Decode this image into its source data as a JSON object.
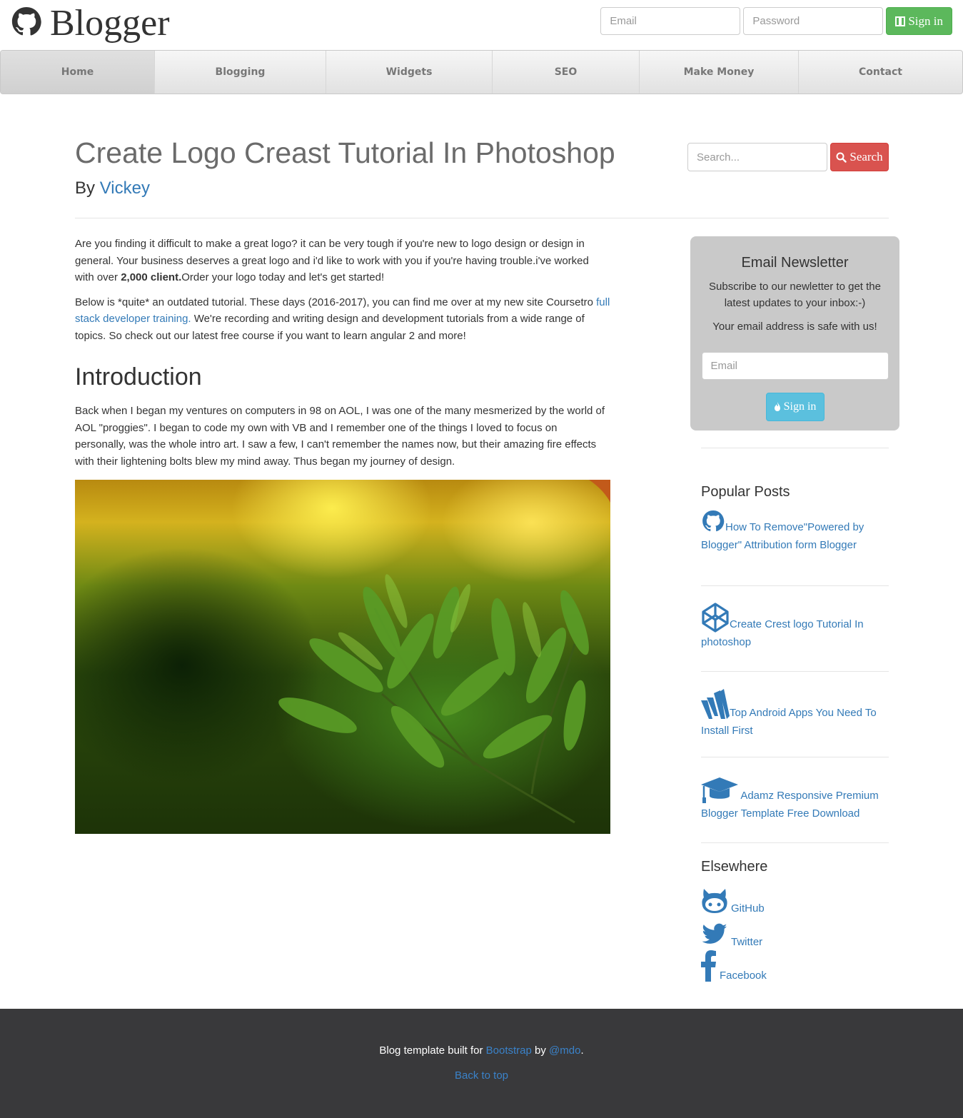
{
  "header": {
    "brand": "Blogger",
    "email_placeholder": "Email",
    "password_placeholder": "Password",
    "signin_label": "Sign in"
  },
  "nav": {
    "items": [
      {
        "label": "Home"
      },
      {
        "label": "Blogging"
      },
      {
        "label": "Widgets"
      },
      {
        "label": "SEO"
      },
      {
        "label": "Make Money"
      },
      {
        "label": "Contact"
      }
    ]
  },
  "post": {
    "title": "Create Logo Creast Tutorial In Photoshop",
    "by_label": "By",
    "author": "Vickey",
    "para1_a": "Are you finding it difficult to make a great logo? it can be very tough if you're new to logo design or design in general. Your business deserves a great logo and i'd like to work with you if you're having trouble.i've worked with over ",
    "para1_bold": "2,000 client.",
    "para1_b": "Order your logo today and let's get started!",
    "para2_a": "Below is *quite* an outdated tutorial. These days (2016-2017), you can find me over at my new site Coursetro ",
    "para2_link": "full stack developer training.",
    "para2_b": " We're recording and writing design and development tutorials from a wide range of topics. So check out our latest free course if you want to learn angular 2 and more!",
    "intro_heading": "Introduction",
    "intro_text": "Back when I began my ventures on computers in 98 on AOL, I was one of the many mesmerized by the world of AOL \"proggies\". I began to code my own with VB and I remember one of the things I loved to focus on personally, was the whole intro art. I saw a few, I can't remember the names now, but their amazing fire effects with their lightening bolts blew my mind away. Thus began my journey of design."
  },
  "search": {
    "placeholder": "Search...",
    "button_label": "Search"
  },
  "newsletter": {
    "title": "Email Newsletter",
    "text1": "Subscribe to our newletter to get the latest updates to your inbox:-)",
    "text2": "Your email address is safe with us!",
    "email_placeholder": "Email",
    "button_label": "Sign in"
  },
  "popular": {
    "heading": "Popular Posts",
    "items": [
      {
        "title": "How To Remove\"Powered by Blogger\" Attribution form Blogger",
        "icon": "github-icon"
      },
      {
        "title": "Create Crest logo Tutorial In photoshop",
        "icon": "codepen-icon"
      },
      {
        "title": "Top Android Apps You Need To Install First",
        "icon": "wordpress-w-icon"
      },
      {
        "title": " Adamz Responsive Premium Blogger Template Free Download",
        "icon": "graduation-cap-icon"
      }
    ]
  },
  "elsewhere": {
    "heading": "Elsewhere",
    "items": [
      {
        "label": "GitHub",
        "icon": "github-alt-icon"
      },
      {
        "label": "Twitter",
        "icon": "twitter-icon"
      },
      {
        "label": "Facebook",
        "icon": "facebook-icon"
      }
    ]
  },
  "footer": {
    "text_a": "Blog template built for ",
    "bootstrap": "Bootstrap",
    "by": " by ",
    "mdo": "@mdo",
    "period": ".",
    "back_to_top": "Back to top"
  },
  "colors": {
    "link": "#337ab7",
    "green_button": "#5cb85c",
    "red_button": "#d9534f",
    "blue_button": "#5bc0de",
    "newsletter_bg": "#c9c9c9",
    "footer_bg": "#39393b"
  }
}
